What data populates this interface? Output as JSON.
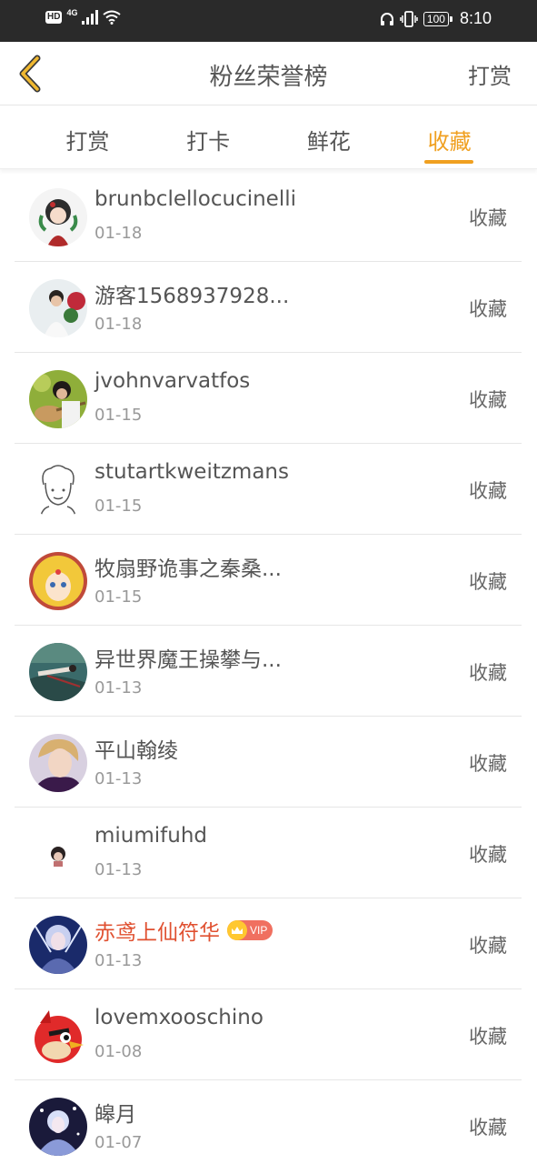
{
  "status_bar": {
    "hd": "HD",
    "network": "4G",
    "battery": "100",
    "time": "8:10"
  },
  "header": {
    "title": "粉丝荣誉榜",
    "action_label": "打赏"
  },
  "tabs": [
    {
      "label": "打赏",
      "active": false
    },
    {
      "label": "打卡",
      "active": false
    },
    {
      "label": "鲜花",
      "active": false
    },
    {
      "label": "收藏",
      "active": true
    }
  ],
  "accent_color": "#f0a020",
  "list": [
    {
      "name": "brunbclellocucinelli",
      "date": "01-18",
      "action": "收藏"
    },
    {
      "name": "游客1568937928...",
      "date": "01-18",
      "action": "收藏"
    },
    {
      "name": "jvohnvarvatfos",
      "date": "01-15",
      "action": "收藏"
    },
    {
      "name": "stutartkweitzmans",
      "date": "01-15",
      "action": "收藏"
    },
    {
      "name": "牧扇野诡事之秦桑...",
      "date": "01-15",
      "action": "收藏"
    },
    {
      "name": "异世界魔王操攀与...",
      "date": "01-13",
      "action": "收藏"
    },
    {
      "name": "平山翰绫",
      "date": "01-13",
      "action": "收藏"
    },
    {
      "name": "miumifuhd",
      "date": "01-13",
      "action": "收藏"
    },
    {
      "name": "赤鸢上仙符华",
      "date": "01-13",
      "action": "收藏",
      "vip": "VIP"
    },
    {
      "name": "lovemxooschino",
      "date": "01-08",
      "action": "收藏"
    },
    {
      "name": "皞月",
      "date": "01-07",
      "action": "收藏"
    }
  ]
}
